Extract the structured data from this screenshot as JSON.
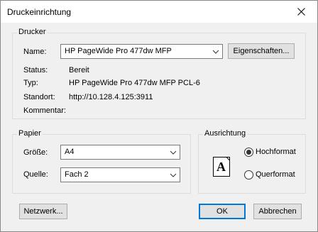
{
  "window": {
    "title": "Druckeinrichtung",
    "close_glyph": "✕"
  },
  "printer": {
    "group_label": "Drucker",
    "name_label": "Name:",
    "name_value": "HP PageWide Pro 477dw MFP",
    "properties_button": "Eigenschaften...",
    "status_label": "Status:",
    "status_value": "Bereit",
    "type_label": "Typ:",
    "type_value": "HP PageWide Pro 477dw MFP PCL-6",
    "location_label": "Standort:",
    "location_value": "http://10.128.4.125:3911",
    "comment_label": "Kommentar:",
    "comment_value": ""
  },
  "paper": {
    "group_label": "Papier",
    "size_label": "Größe:",
    "size_value": "A4",
    "source_label": "Quelle:",
    "source_value": "Fach 2"
  },
  "orientation": {
    "group_label": "Ausrichtung",
    "page_glyph": "A",
    "portrait_label": "Hochformat",
    "landscape_label": "Querformat",
    "selected": "portrait"
  },
  "buttons": {
    "network": "Netzwerk...",
    "ok": "OK",
    "cancel": "Abbrechen"
  },
  "icons": {
    "close": "close-icon",
    "dropdown": "chevron-down-icon",
    "page": "page-portrait-icon"
  },
  "colors": {
    "accent": "#0078d7",
    "background": "#f0f0f0"
  }
}
